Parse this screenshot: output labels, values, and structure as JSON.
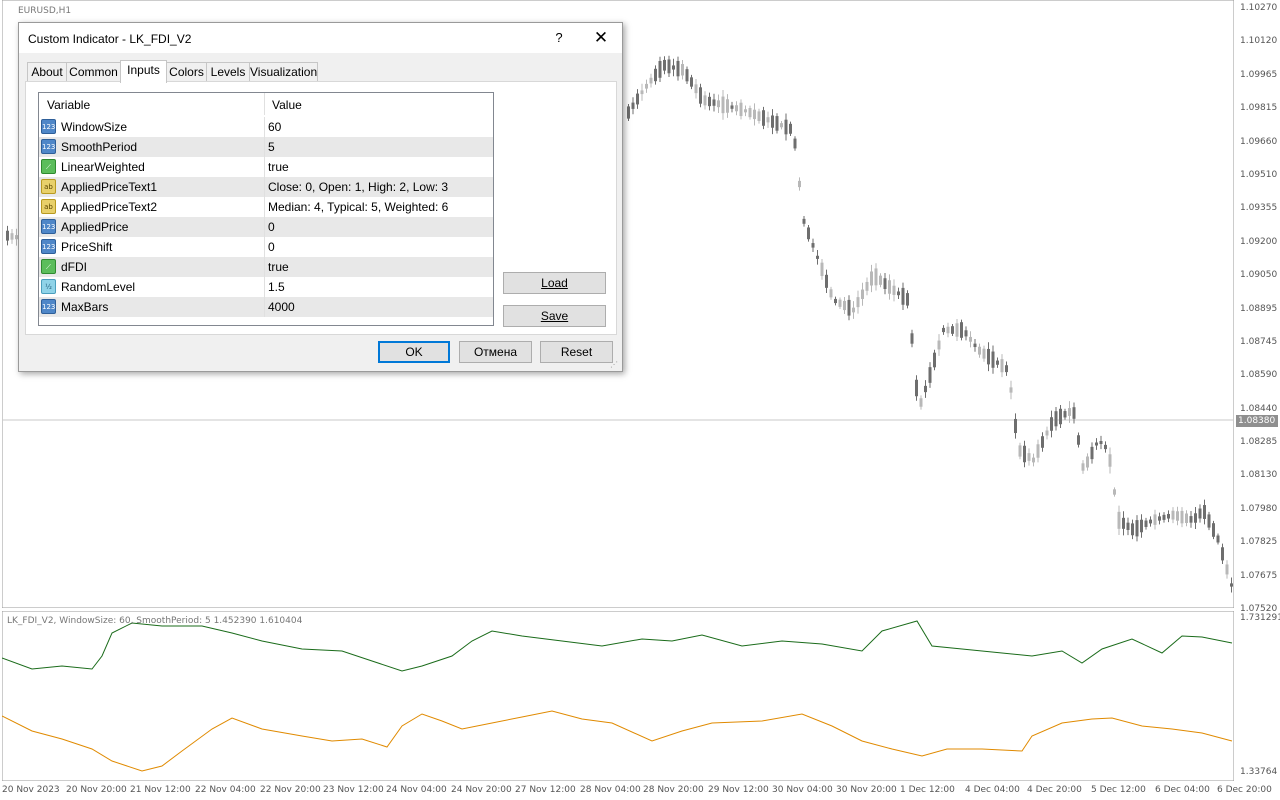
{
  "chart": {
    "symbol_title": "EURUSD,H1",
    "indicator_title": "LK_FDI_V2, WindowSize: 60, SmoothPeriod: 5  1.452390 1.610404",
    "current_price": "1.08380",
    "price_labels": [
      "1.10270",
      "1.10120",
      "1.09965",
      "1.09815",
      "1.09660",
      "1.09510",
      "1.09355",
      "1.09200",
      "1.09050",
      "1.08895",
      "1.08745",
      "1.08590",
      "1.08440",
      "1.08285",
      "1.08130",
      "1.07980",
      "1.07825",
      "1.07675",
      "1.07520"
    ],
    "indicator_scale_labels": [
      "1.731291",
      "1.33764"
    ],
    "time_labels": [
      "20 Nov 2023",
      "20 Nov 20:00",
      "21 Nov 12:00",
      "22 Nov 04:00",
      "22 Nov 20:00",
      "23 Nov 12:00",
      "24 Nov 04:00",
      "24 Nov 20:00",
      "27 Nov 12:00",
      "28 Nov 04:00",
      "28 Nov 20:00",
      "29 Nov 12:00",
      "30 Nov 04:00",
      "30 Nov 20:00",
      "1 Dec 12:00",
      "4 Dec 04:00",
      "4 Dec 20:00",
      "5 Dec 12:00",
      "6 Dec 04:00",
      "6 Dec 20:00"
    ],
    "colors": {
      "fdi_line": "#1a6b1a",
      "smooth_line": "#e08a00",
      "candle_bear": "#6e6e6e",
      "candle_bull": "#b8b8b8"
    }
  },
  "dialog": {
    "title": "Custom Indicator - LK_FDI_V2",
    "help_label": "?",
    "close_label": "✕",
    "tabs": [
      "About",
      "Common",
      "Inputs",
      "Colors",
      "Levels",
      "Visualization"
    ],
    "active_tab": "Inputs",
    "table": {
      "headers": [
        "Variable",
        "Value"
      ],
      "rows": [
        {
          "icon": "int",
          "icon_text": "123",
          "variable": "WindowSize",
          "value": "60"
        },
        {
          "icon": "int",
          "icon_text": "123",
          "variable": "SmoothPeriod",
          "value": "5"
        },
        {
          "icon": "bool",
          "icon_text": "⟋",
          "variable": "LinearWeighted",
          "value": "true"
        },
        {
          "icon": "str",
          "icon_text": "ab",
          "variable": "AppliedPriceText1",
          "value": "Close: 0, Open: 1, High: 2, Low: 3"
        },
        {
          "icon": "str",
          "icon_text": "ab",
          "variable": "AppliedPriceText2",
          "value": "Median: 4, Typical: 5, Weighted: 6"
        },
        {
          "icon": "int",
          "icon_text": "123",
          "variable": "AppliedPrice",
          "value": "0"
        },
        {
          "icon": "int",
          "icon_text": "123",
          "variable": "PriceShift",
          "value": "0"
        },
        {
          "icon": "bool",
          "icon_text": "⟋",
          "variable": "dFDI",
          "value": "true"
        },
        {
          "icon": "dbl",
          "icon_text": "½",
          "variable": "RandomLevel",
          "value": "1.5"
        },
        {
          "icon": "int",
          "icon_text": "123",
          "variable": "MaxBars",
          "value": "4000"
        }
      ]
    },
    "buttons": {
      "load": "Load",
      "save": "Save",
      "ok": "OK",
      "cancel": "Отмена",
      "reset": "Reset"
    }
  }
}
